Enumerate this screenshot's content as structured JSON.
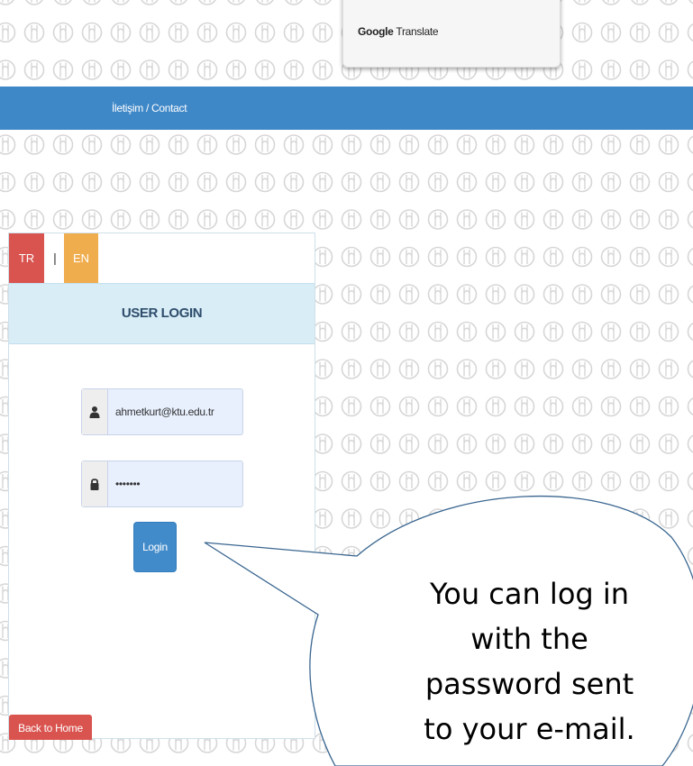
{
  "google_translate": {
    "brand": "Google",
    "label": "Translate"
  },
  "navbar": {
    "contact_label": "İletişim / Contact"
  },
  "language": {
    "tr_label": "TR",
    "separator": "|",
    "en_label": "EN"
  },
  "login": {
    "title": "USER LOGIN",
    "email_value": "ahmetkurt@ktu.edu.tr",
    "password_value": "•••••••",
    "login_label": "Login",
    "back_label": "Back to Home"
  },
  "callout": {
    "lines": [
      "You can log in",
      "with the",
      "password sent",
      "to your e-mail."
    ]
  },
  "colors": {
    "navbar": "#3f88c8",
    "tr_button": "#d9534f",
    "en_button": "#f0ad4e",
    "panel_heading": "#d9edf7",
    "login_button": "#428bca",
    "back_button": "#d9534f",
    "pattern": "#d8d8d8"
  },
  "icons": {
    "email_addon": "user-icon",
    "password_addon": "lock-icon",
    "background": "logo-pattern-icon"
  }
}
